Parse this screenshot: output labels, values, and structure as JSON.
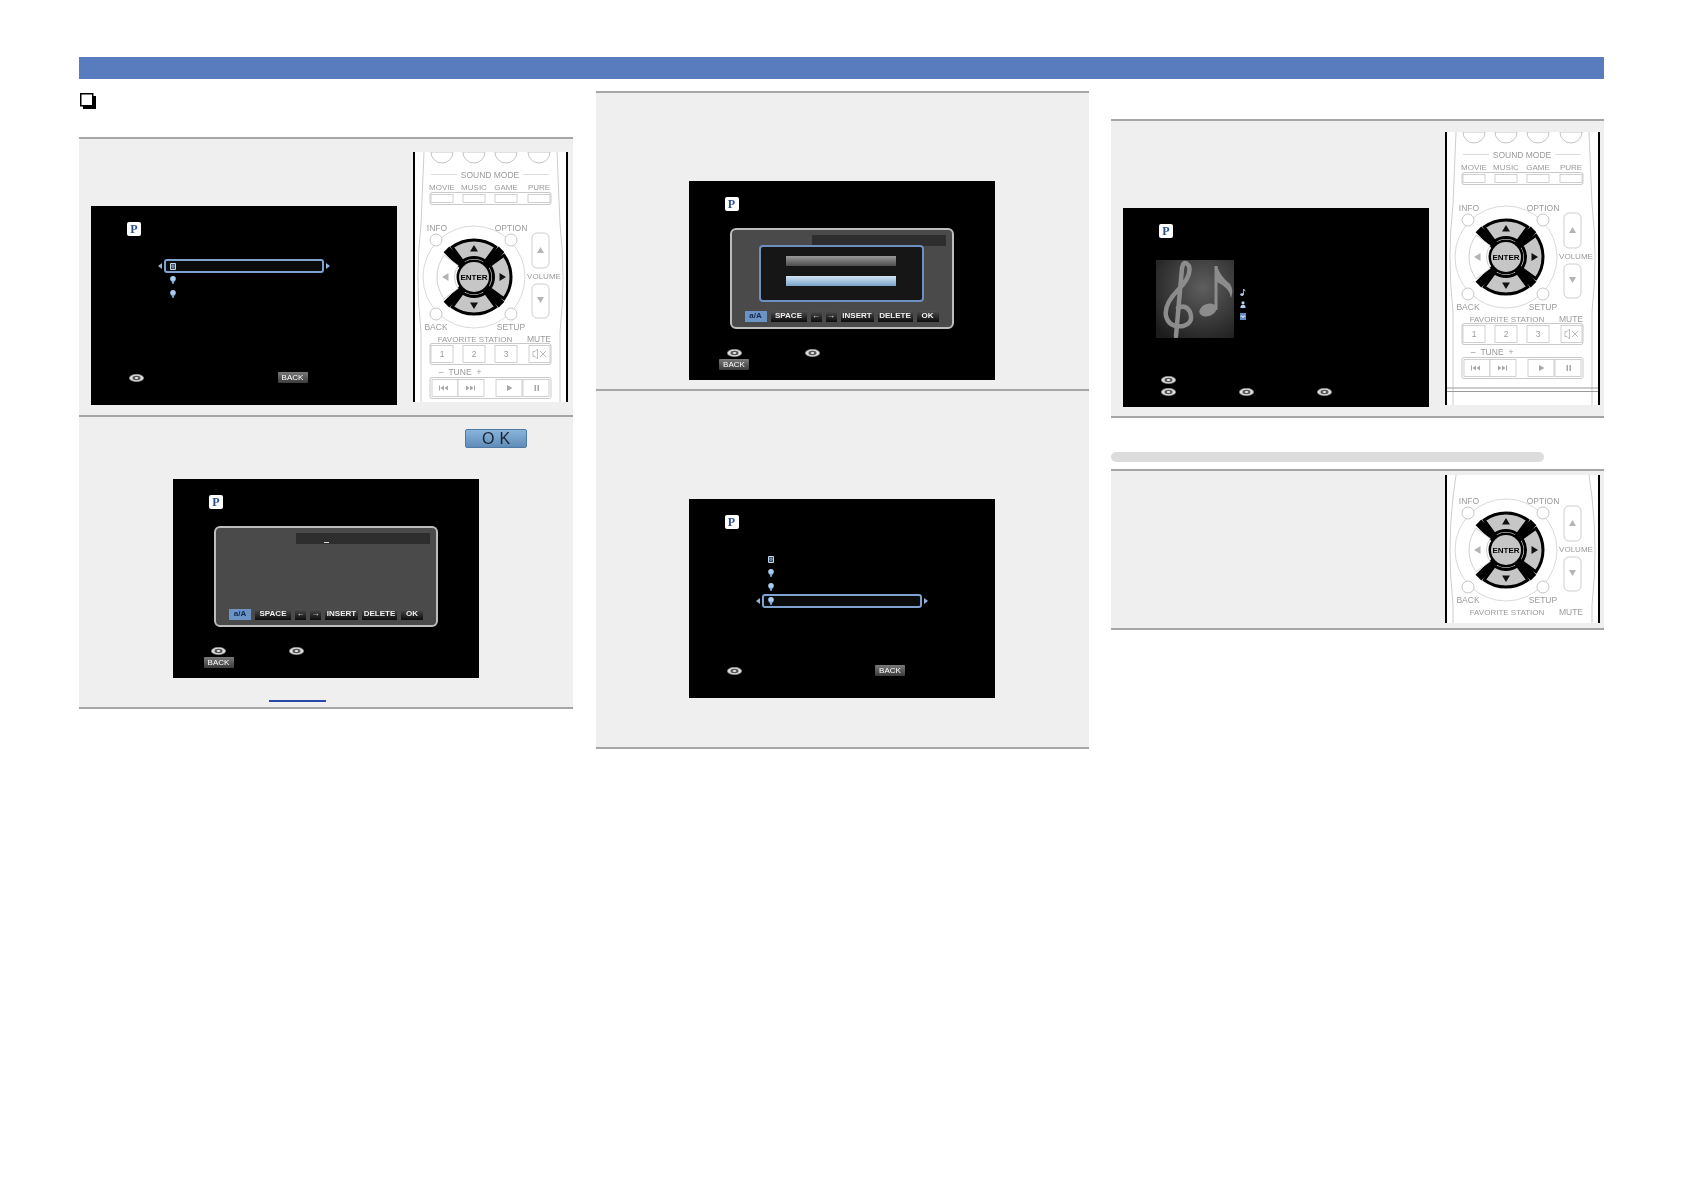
{
  "columns": [
    {
      "blocks": [
        {
          "kind": "heading"
        },
        {
          "kind": "panel",
          "screen": {
            "kind": "list",
            "logo": "P",
            "rows": [
              {
                "kind": "action",
                "selected": true
              },
              {
                "kind": "station",
                "selected": false
              },
              {
                "kind": "station",
                "selected": false
              }
            ],
            "footer": [
              [
                {
                  "kind": "dpad"
                },
                {
                  "kind": "spacer"
                },
                {
                  "kind": "back",
                  "label": "BACK"
                }
              ]
            ]
          },
          "remote": {
            "kind": "short",
            "sound_mode": "SOUND MODE",
            "mode_labels": [
              "MOVIE",
              "MUSIC",
              "GAME",
              "PURE"
            ],
            "info": "INFO",
            "option": "OPTION",
            "enter": "ENTER",
            "volume": "VOLUME",
            "back": "BACK",
            "setup": "SETUP",
            "favorite_station": "FAVORITE STATION",
            "mute": "MUTE",
            "station_buttons": [
              "1",
              "2",
              "3"
            ],
            "tune_minus": "–",
            "tune": "TUNE",
            "tune_plus": "+",
            "highlight": {
              "up": true,
              "right": true,
              "down": true,
              "left": false,
              "enter": true
            }
          }
        },
        {
          "kind": "panel",
          "button": {
            "label": "OK"
          },
          "screen": {
            "kind": "keyboard",
            "logo": "P",
            "cursor": true,
            "keys": [
              {
                "label": "a/A",
                "selected": true
              },
              {
                "label": "SPACE",
                "selected": false
              },
              {
                "label": "←",
                "selected": false
              },
              {
                "label": "→",
                "selected": false
              },
              {
                "label": "INSERT",
                "selected": false
              },
              {
                "label": "DELETE",
                "selected": false
              },
              {
                "label": "OK",
                "selected": false
              }
            ],
            "footer": [
              [
                {
                  "kind": "dpad"
                },
                {
                  "kind": "dpad"
                }
              ],
              [
                {
                  "kind": "back",
                  "label": "BACK"
                }
              ]
            ]
          },
          "link_underline": true
        }
      ]
    },
    {
      "blocks": [
        {
          "kind": "panel",
          "screen": {
            "kind": "keyboard",
            "logo": "P",
            "keys": [
              {
                "label": "a/A",
                "selected": true
              },
              {
                "label": "SPACE",
                "selected": false
              },
              {
                "label": "←",
                "selected": false
              },
              {
                "label": "→",
                "selected": false
              },
              {
                "label": "INSERT",
                "selected": false
              },
              {
                "label": "DELETE",
                "selected": false
              },
              {
                "label": "OK",
                "selected": false
              }
            ],
            "popup_options": [
              {
                "selected": false
              },
              {
                "selected": true
              }
            ],
            "footer": [
              [
                {
                  "kind": "dpad"
                },
                {
                  "kind": "dpad"
                }
              ],
              [
                {
                  "kind": "back",
                  "label": "BACK"
                }
              ]
            ]
          }
        },
        {
          "kind": "panel",
          "screen": {
            "kind": "list",
            "logo": "P",
            "rows": [
              {
                "kind": "action",
                "selected": false
              },
              {
                "kind": "station",
                "selected": false
              },
              {
                "kind": "station",
                "selected": false
              },
              {
                "kind": "station",
                "selected": true
              }
            ],
            "footer": [
              [
                {
                  "kind": "dpad"
                },
                {
                  "kind": "spacer"
                },
                {
                  "kind": "back",
                  "label": "BACK"
                }
              ]
            ]
          }
        }
      ]
    },
    {
      "blocks": [
        {
          "kind": "panel",
          "screen": {
            "kind": "now_playing",
            "logo": "P",
            "info_rows": [
              {
                "kind": "song"
              },
              {
                "kind": "artist"
              },
              {
                "kind": "album"
              }
            ],
            "footer": [
              [
                {
                  "kind": "dpad"
                }
              ],
              [
                {
                  "kind": "dpad"
                },
                {
                  "kind": "dpad"
                },
                {
                  "kind": "dpad"
                }
              ]
            ]
          },
          "remote": {
            "kind": "tall",
            "sound_mode": "SOUND MODE",
            "mode_labels": [
              "MOVIE",
              "MUSIC",
              "GAME",
              "PURE"
            ],
            "info": "INFO",
            "option": "OPTION",
            "enter": "ENTER",
            "volume": "VOLUME",
            "back": "BACK",
            "setup": "SETUP",
            "favorite_station": "FAVORITE STATION",
            "mute": "MUTE",
            "station_buttons": [
              "1",
              "2",
              "3"
            ],
            "tune_minus": "–",
            "tune": "TUNE",
            "tune_plus": "+",
            "highlight": {
              "up": true,
              "right": true,
              "down": true,
              "left": false,
              "enter": true
            }
          }
        },
        {
          "kind": "subheading"
        },
        {
          "kind": "panel",
          "remote": {
            "kind": "middle",
            "info": "INFO",
            "option": "OPTION",
            "enter": "ENTER",
            "volume": "VOLUME",
            "back": "BACK",
            "setup": "SETUP",
            "favorite_station": "FAVORITE STATION",
            "mute": "MUTE",
            "highlight": {
              "up": true,
              "right": true,
              "down": true,
              "left": false,
              "enter": true
            }
          }
        }
      ]
    }
  ]
}
